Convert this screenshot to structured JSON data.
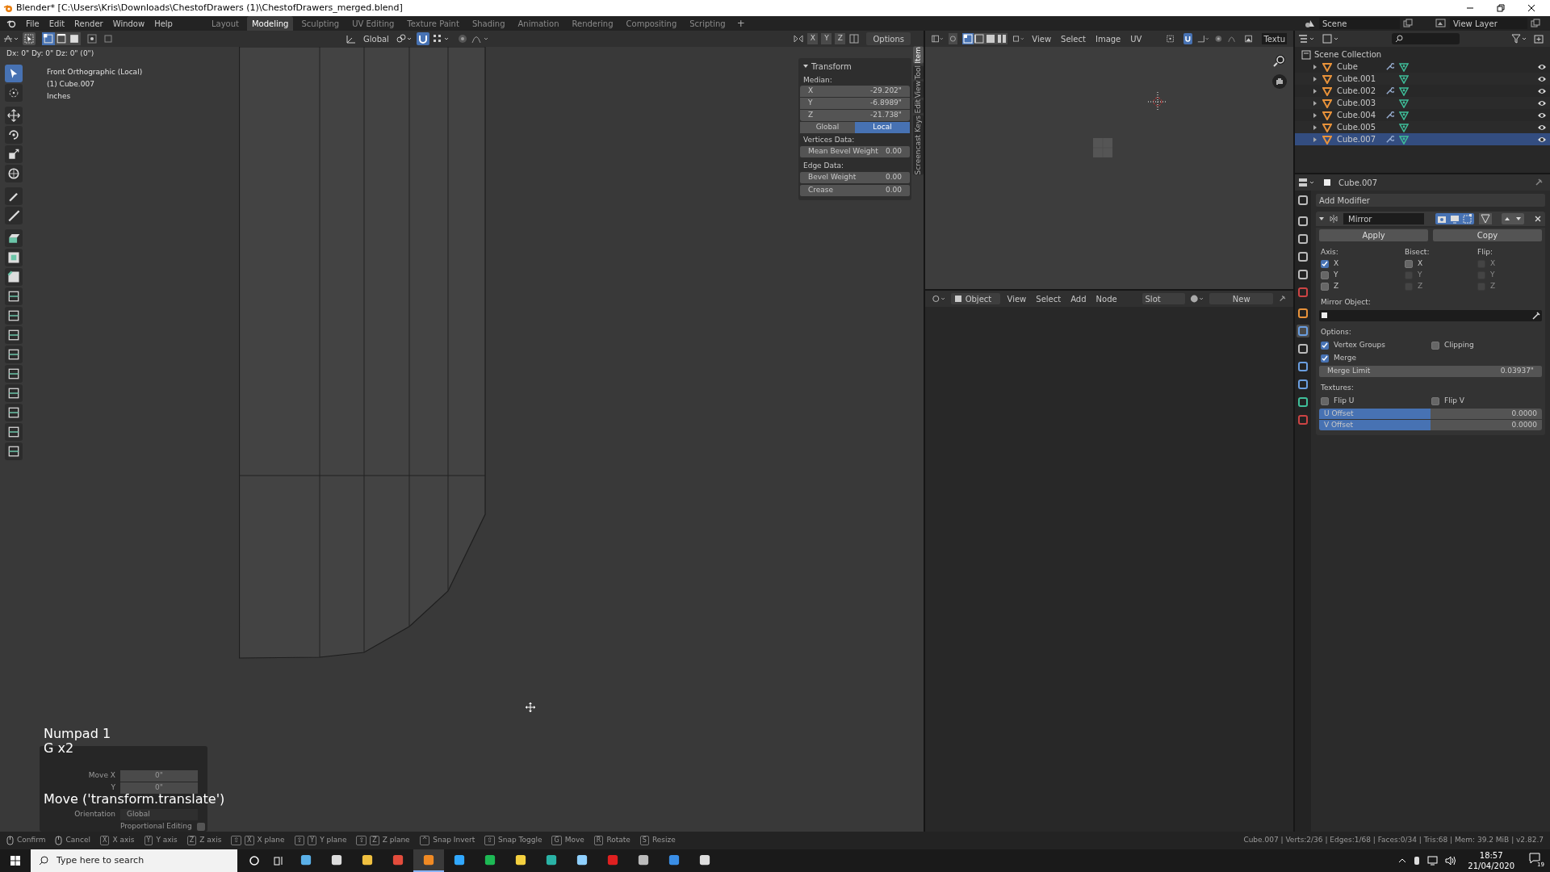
{
  "window": {
    "title": "Blender* [C:\\Users\\Kris\\Downloads\\ChestofDrawers (1)\\ChestofDrawers_merged.blend]"
  },
  "menu": [
    "File",
    "Edit",
    "Render",
    "Window",
    "Help"
  ],
  "workspaces": [
    {
      "label": "Layout",
      "selected": false
    },
    {
      "label": "Modeling",
      "selected": true
    },
    {
      "label": "Sculpting",
      "selected": false
    },
    {
      "label": "UV Editing",
      "selected": false
    },
    {
      "label": "Texture Paint",
      "selected": false
    },
    {
      "label": "Shading",
      "selected": false
    },
    {
      "label": "Animation",
      "selected": false
    },
    {
      "label": "Rendering",
      "selected": false
    },
    {
      "label": "Compositing",
      "selected": false
    },
    {
      "label": "Scripting",
      "selected": false
    }
  ],
  "add_workspace": "+",
  "scene": {
    "scene": "Scene",
    "view_layer": "View Layer"
  },
  "viewport": {
    "select_modes": [
      {
        "kind": "vertex",
        "selected": true
      },
      {
        "kind": "edge",
        "selected": false
      },
      {
        "kind": "face",
        "selected": false
      }
    ],
    "orientation": "Global",
    "snap": true,
    "axes": [
      "X",
      "Y",
      "Z"
    ],
    "options": "Options",
    "drag_info": "Dx: 0\"  Dy: 0\"  Dz: 0\" (0\")",
    "overlay": [
      "Front Orthographic (Local)",
      "(1) Cube.007",
      "Inches"
    ],
    "tools": [
      {
        "kind": "select",
        "selected": true
      },
      {
        "kind": "cursor",
        "selected": false
      },
      {
        "kind": "move",
        "selected": false
      },
      {
        "kind": "rotate",
        "selected": false
      },
      {
        "kind": "scale",
        "selected": false
      },
      {
        "kind": "transform",
        "selected": false
      },
      {
        "kind": "annotate",
        "selected": false
      },
      {
        "kind": "measure",
        "selected": false
      },
      {
        "kind": "extrude",
        "selected": false
      },
      {
        "kind": "inset",
        "selected": false
      },
      {
        "kind": "bevel",
        "selected": false
      },
      {
        "kind": "loopcut",
        "selected": false
      },
      {
        "kind": "knife",
        "selected": false
      },
      {
        "kind": "polybuild",
        "selected": false
      },
      {
        "kind": "spin",
        "selected": false
      },
      {
        "kind": "smooth",
        "selected": false
      },
      {
        "kind": "slide",
        "selected": false
      },
      {
        "kind": "shrink",
        "selected": false
      },
      {
        "kind": "shear",
        "selected": false
      },
      {
        "kind": "rip",
        "selected": false
      }
    ],
    "sidebar_tabs": [
      {
        "label": "Item",
        "selected": true
      },
      {
        "label": "Tool",
        "selected": false
      },
      {
        "label": "View",
        "selected": false
      },
      {
        "label": "Edit",
        "selected": false
      },
      {
        "label": "Screencast Keys",
        "selected": false
      }
    ],
    "transform": {
      "title": "Transform",
      "median": "Median:",
      "fields": [
        {
          "label": "X",
          "value": "-29.202\""
        },
        {
          "label": "Y",
          "value": "-6.8989\""
        },
        {
          "label": "Z",
          "value": "-21.738\""
        }
      ],
      "spaces": [
        {
          "label": "Global",
          "selected": false
        },
        {
          "label": "Local",
          "selected": true
        }
      ],
      "vertices_heading": "Vertices Data:",
      "vertices": [
        {
          "label": "Mean Bevel Weight",
          "value": "0.00"
        }
      ],
      "edge_heading": "Edge Data:",
      "edges": [
        {
          "label": "Bevel Weight",
          "value": "0.00"
        },
        {
          "label": "Crease",
          "value": "0.00"
        }
      ]
    },
    "keystrokes": [
      "Numpad 1",
      "G x2"
    ],
    "operator": "Move ('transform.translate')",
    "move_panel": {
      "rows": [
        {
          "label": "Move X",
          "value": "0\""
        },
        {
          "label": "Y",
          "value": "0\""
        }
      ],
      "orientation_label": "Orientation",
      "orientation": "Global",
      "proportional_label": "Proportional Editing",
      "proportional": false
    }
  },
  "image_editor": {
    "menus": [
      "View",
      "Select",
      "Image",
      "UV"
    ],
    "texture": "Textu"
  },
  "node_editor": {
    "mode": "Object",
    "menus": [
      "View",
      "Select",
      "Add",
      "Node"
    ],
    "slot": "Slot",
    "new": "New"
  },
  "outliner": {
    "root": "Scene Collection",
    "items": [
      {
        "name": "Cube",
        "modifier": true,
        "selected": false
      },
      {
        "name": "Cube.001",
        "modifier": false,
        "selected": false
      },
      {
        "name": "Cube.002",
        "modifier": true,
        "selected": false
      },
      {
        "name": "Cube.003",
        "modifier": false,
        "selected": false
      },
      {
        "name": "Cube.004",
        "modifier": true,
        "selected": false
      },
      {
        "name": "Cube.005",
        "modifier": false,
        "selected": false
      },
      {
        "name": "Cube.007",
        "modifier": true,
        "selected": true
      }
    ]
  },
  "properties": {
    "object": "Cube.007",
    "tabs": [
      {
        "kind": "tool",
        "selected": false
      },
      {
        "kind": "render",
        "selected": false
      },
      {
        "kind": "output",
        "selected": false
      },
      {
        "kind": "viewlayer",
        "selected": false
      },
      {
        "kind": "scene",
        "selected": false
      },
      {
        "kind": "world",
        "selected": false
      },
      {
        "kind": "object",
        "selected": false
      },
      {
        "kind": "modifier",
        "selected": true
      },
      {
        "kind": "particles",
        "selected": false
      },
      {
        "kind": "physics",
        "selected": false
      },
      {
        "kind": "constraints",
        "selected": false
      },
      {
        "kind": "data",
        "selected": false
      },
      {
        "kind": "material",
        "selected": false
      }
    ],
    "add_modifier": "Add Modifier",
    "modifier_name": "Mirror",
    "apply": "Apply",
    "copy": "Copy",
    "columns": [
      {
        "heading": "Axis:",
        "boxes": [
          {
            "label": "X",
            "checked": true,
            "disabled": false
          },
          {
            "label": "Y",
            "checked": false,
            "disabled": false
          },
          {
            "label": "Z",
            "checked": false,
            "disabled": false
          }
        ]
      },
      {
        "heading": "Bisect:",
        "boxes": [
          {
            "label": "X",
            "checked": false,
            "disabled": false
          },
          {
            "label": "Y",
            "checked": false,
            "disabled": true
          },
          {
            "label": "Z",
            "checked": false,
            "disabled": true
          }
        ]
      },
      {
        "heading": "Flip:",
        "boxes": [
          {
            "label": "X",
            "checked": false,
            "disabled": true
          },
          {
            "label": "Y",
            "checked": false,
            "disabled": true
          },
          {
            "label": "Z",
            "checked": false,
            "disabled": true
          }
        ]
      }
    ],
    "mirror_object": "Mirror Object:",
    "options_heading": "Options:",
    "vertex_groups": {
      "label": "Vertex Groups",
      "checked": true
    },
    "clipping": {
      "label": "Clipping",
      "checked": false
    },
    "merge": {
      "label": "Merge",
      "checked": true
    },
    "merge_limit": {
      "label": "Merge Limit",
      "value": "0.03937\""
    },
    "textures_heading": "Textures:",
    "flip_u": {
      "label": "Flip U",
      "checked": false
    },
    "flip_v": {
      "label": "Flip V",
      "checked": false
    },
    "offsets": [
      {
        "label": "U Offset",
        "value": "0.0000",
        "level": 0.5
      },
      {
        "label": "V Offset",
        "value": "0.0000",
        "level": 0.5
      }
    ]
  },
  "status_bar": {
    "hints": [
      {
        "kind": "mouse",
        "label": "Confirm"
      },
      {
        "kind": "mouse",
        "label": "Cancel"
      },
      {
        "kind": "key",
        "keys": [
          "X"
        ],
        "label": "X axis"
      },
      {
        "kind": "key",
        "keys": [
          "Y"
        ],
        "label": "Y axis"
      },
      {
        "kind": "key",
        "keys": [
          "Z"
        ],
        "label": "Z axis"
      },
      {
        "kind": "key",
        "keys": [
          "⇧",
          "X"
        ],
        "label": "X plane"
      },
      {
        "kind": "key",
        "keys": [
          "⇧",
          "Y"
        ],
        "label": "Y plane"
      },
      {
        "kind": "key",
        "keys": [
          "⇧",
          "Z"
        ],
        "label": "Z plane"
      },
      {
        "kind": "key",
        "keys": [
          "^"
        ],
        "label": "Snap Invert"
      },
      {
        "kind": "key",
        "keys": [
          "⇧"
        ],
        "label": "Snap Toggle"
      },
      {
        "kind": "key",
        "keys": [
          "G"
        ],
        "label": "Move"
      },
      {
        "kind": "key",
        "keys": [
          "R"
        ],
        "label": "Rotate"
      },
      {
        "kind": "key",
        "keys": [
          "S"
        ],
        "label": "Resize"
      }
    ],
    "stats": "Cube.007 | Verts:2/36 | Edges:1/68 | Faces:0/34 | Tris:68 | Mem: 39.2 MiB | v2.82.7"
  },
  "taskbar": {
    "search": "Type here to search",
    "apps": [
      {
        "kind": "terminal",
        "selected": false
      },
      {
        "kind": "drive",
        "selected": false
      },
      {
        "kind": "folder",
        "selected": false
      },
      {
        "kind": "browser",
        "selected": false
      },
      {
        "kind": "blender",
        "selected": true
      },
      {
        "kind": "photo-editor",
        "selected": false
      },
      {
        "kind": "music",
        "selected": false
      },
      {
        "kind": "notes",
        "selected": false
      },
      {
        "kind": "modeler",
        "selected": false
      },
      {
        "kind": "cube",
        "selected": false
      },
      {
        "kind": "red-app",
        "selected": false
      },
      {
        "kind": "stack",
        "selected": false
      },
      {
        "kind": "photos",
        "selected": false
      },
      {
        "kind": "clock",
        "selected": false
      }
    ],
    "time": "18:57",
    "date": "21/04/2020",
    "notifications": "19"
  }
}
